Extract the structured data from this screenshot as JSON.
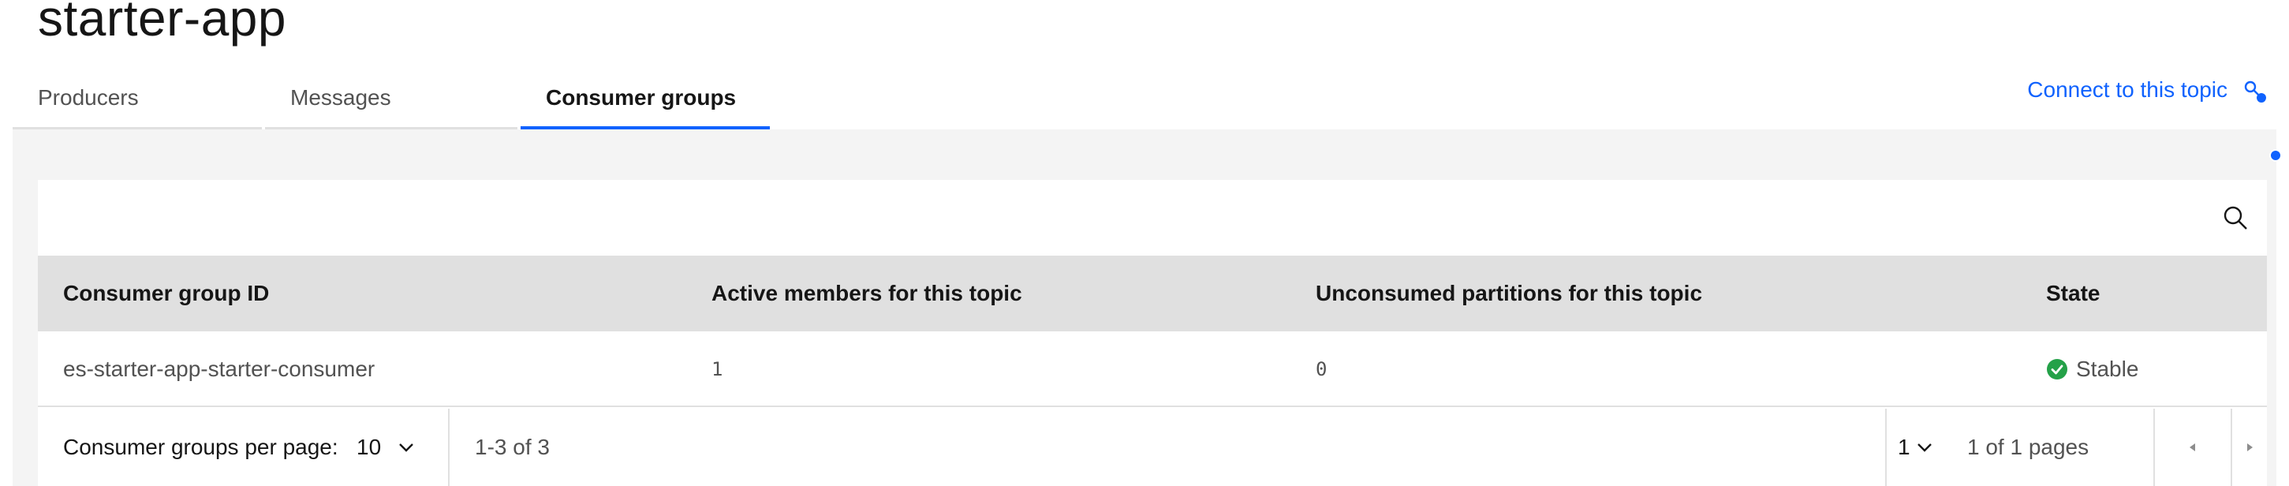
{
  "page": {
    "title": "starter-app"
  },
  "tabs": [
    {
      "label": "Producers",
      "active": false
    },
    {
      "label": "Messages",
      "active": false
    },
    {
      "label": "Consumer groups",
      "active": true
    }
  ],
  "header": {
    "connect_link": "Connect to this topic",
    "connect_icon": "connect-icon"
  },
  "colors": {
    "accent": "#0f62fe",
    "success": "#24a148",
    "header_bg": "#e0e0e0",
    "page_bg": "#f4f4f4"
  },
  "table": {
    "search_icon": "search-icon",
    "columns": [
      "Consumer group ID",
      "Active members for this topic",
      "Unconsumed partitions for this topic",
      "State"
    ],
    "rows": [
      {
        "id": "es-starter-app-starter-consumer",
        "active_members": "1",
        "unconsumed_partitions": "0",
        "state": "Stable",
        "state_icon": "checkmark-filled-icon"
      }
    ]
  },
  "pagination": {
    "per_page_label": "Consumer groups per page:",
    "per_page_value": "10",
    "range_text": "1-3 of 3",
    "page_value": "1",
    "pages_text": "1 of 1 pages",
    "prev_icon": "caret-left-icon",
    "next_icon": "caret-right-icon"
  }
}
